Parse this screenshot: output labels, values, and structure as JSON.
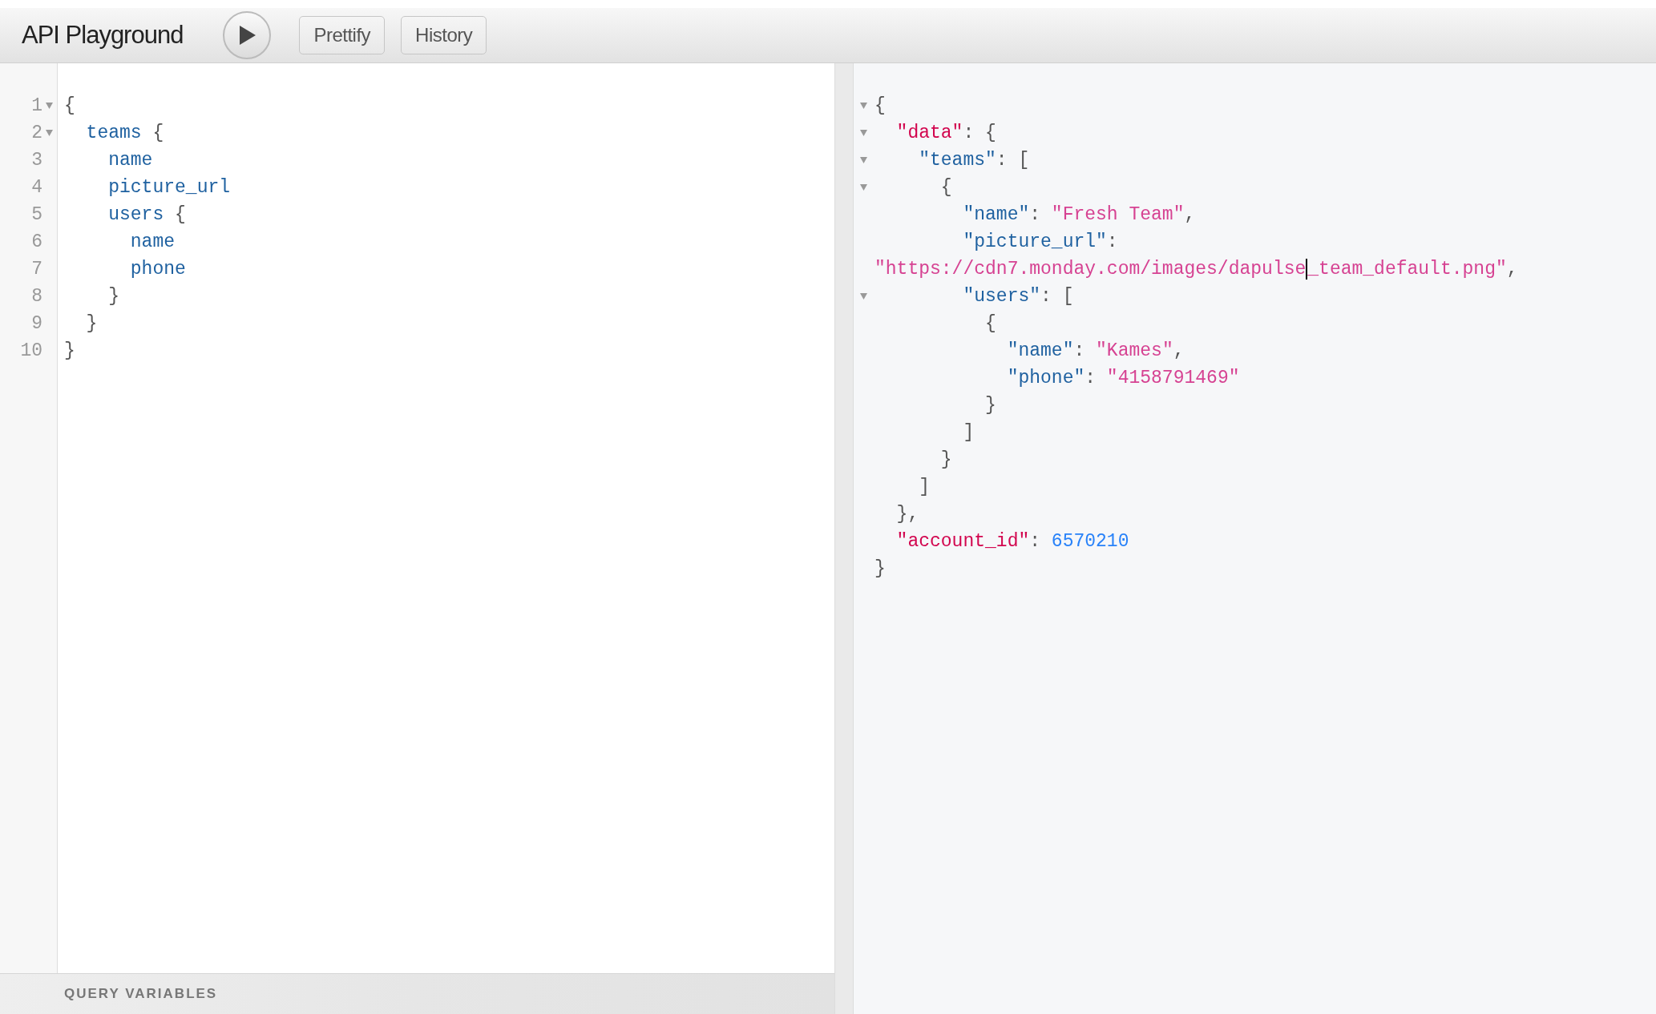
{
  "toolbar": {
    "title": "API Playground",
    "buttons": [
      "Prettify",
      "History"
    ]
  },
  "query_editor": {
    "lines": [
      {
        "number": "1",
        "foldable": true,
        "tokens": [
          {
            "kind": "punct",
            "text": "{"
          }
        ]
      },
      {
        "number": "2",
        "foldable": true,
        "tokens": [
          {
            "kind": "field",
            "text": "  teams"
          },
          {
            "kind": "punct",
            "text": " {"
          }
        ]
      },
      {
        "number": "3",
        "foldable": false,
        "tokens": [
          {
            "kind": "field",
            "text": "    name"
          }
        ]
      },
      {
        "number": "4",
        "foldable": false,
        "tokens": [
          {
            "kind": "field",
            "text": "    picture_url"
          }
        ]
      },
      {
        "number": "5",
        "foldable": false,
        "tokens": [
          {
            "kind": "field",
            "text": "    users"
          },
          {
            "kind": "punct",
            "text": " {"
          }
        ]
      },
      {
        "number": "6",
        "foldable": false,
        "tokens": [
          {
            "kind": "field",
            "text": "      name"
          }
        ]
      },
      {
        "number": "7",
        "foldable": false,
        "tokens": [
          {
            "kind": "field",
            "text": "      phone"
          }
        ]
      },
      {
        "number": "8",
        "foldable": false,
        "tokens": [
          {
            "kind": "punct",
            "text": "    }"
          }
        ]
      },
      {
        "number": "9",
        "foldable": false,
        "tokens": [
          {
            "kind": "punct",
            "text": "  }"
          }
        ]
      },
      {
        "number": "10",
        "foldable": false,
        "tokens": [
          {
            "kind": "punct",
            "text": "}"
          }
        ]
      }
    ]
  },
  "result_viewer": {
    "lines": [
      {
        "foldable": true,
        "tokens": [
          {
            "kind": "punct",
            "text": "{"
          }
        ]
      },
      {
        "foldable": true,
        "tokens": [
          {
            "kind": "key",
            "text": "  \"data\""
          },
          {
            "kind": "punct",
            "text": ": {"
          }
        ]
      },
      {
        "foldable": true,
        "tokens": [
          {
            "kind": "field",
            "text": "    \"teams\""
          },
          {
            "kind": "punct",
            "text": ": ["
          }
        ]
      },
      {
        "foldable": true,
        "tokens": [
          {
            "kind": "punct",
            "text": "      {"
          }
        ]
      },
      {
        "foldable": false,
        "tokens": [
          {
            "kind": "field",
            "text": "        \"name\""
          },
          {
            "kind": "punct",
            "text": ": "
          },
          {
            "kind": "string",
            "text": "\"Fresh Team\""
          },
          {
            "kind": "punct",
            "text": ","
          }
        ]
      },
      {
        "foldable": false,
        "tokens": [
          {
            "kind": "field",
            "text": "        \"picture_url\""
          },
          {
            "kind": "punct",
            "text": ":"
          }
        ]
      },
      {
        "foldable": false,
        "tokens": [
          {
            "kind": "string",
            "text": "\"https://cdn7.monday.com/images/dapulse"
          },
          {
            "kind": "cursor"
          },
          {
            "kind": "string",
            "text": "_team_default.png\""
          },
          {
            "kind": "punct",
            "text": ","
          }
        ]
      },
      {
        "foldable": true,
        "tokens": [
          {
            "kind": "field",
            "text": "        \"users\""
          },
          {
            "kind": "punct",
            "text": ": ["
          }
        ]
      },
      {
        "foldable": false,
        "tokens": [
          {
            "kind": "punct",
            "text": "          {"
          }
        ]
      },
      {
        "foldable": false,
        "tokens": [
          {
            "kind": "field",
            "text": "            \"name\""
          },
          {
            "kind": "punct",
            "text": ": "
          },
          {
            "kind": "string",
            "text": "\"Kames\""
          },
          {
            "kind": "punct",
            "text": ","
          }
        ]
      },
      {
        "foldable": false,
        "tokens": [
          {
            "kind": "field",
            "text": "            \"phone\""
          },
          {
            "kind": "punct",
            "text": ": "
          },
          {
            "kind": "string",
            "text": "\"4158791469\""
          }
        ]
      },
      {
        "foldable": false,
        "tokens": [
          {
            "kind": "punct",
            "text": "          }"
          }
        ]
      },
      {
        "foldable": false,
        "tokens": [
          {
            "kind": "punct",
            "text": "        ]"
          }
        ]
      },
      {
        "foldable": false,
        "tokens": [
          {
            "kind": "punct",
            "text": "      }"
          }
        ]
      },
      {
        "foldable": false,
        "tokens": [
          {
            "kind": "punct",
            "text": "    ]"
          }
        ]
      },
      {
        "foldable": false,
        "tokens": [
          {
            "kind": "punct",
            "text": "  },"
          }
        ]
      },
      {
        "foldable": false,
        "tokens": [
          {
            "kind": "key",
            "text": "  \"account_id\""
          },
          {
            "kind": "punct",
            "text": ": "
          },
          {
            "kind": "number",
            "text": "6570210"
          }
        ]
      },
      {
        "foldable": false,
        "tokens": [
          {
            "kind": "punct",
            "text": "}"
          }
        ]
      }
    ]
  },
  "query_variables": {
    "label": "QUERY VARIABLES"
  }
}
